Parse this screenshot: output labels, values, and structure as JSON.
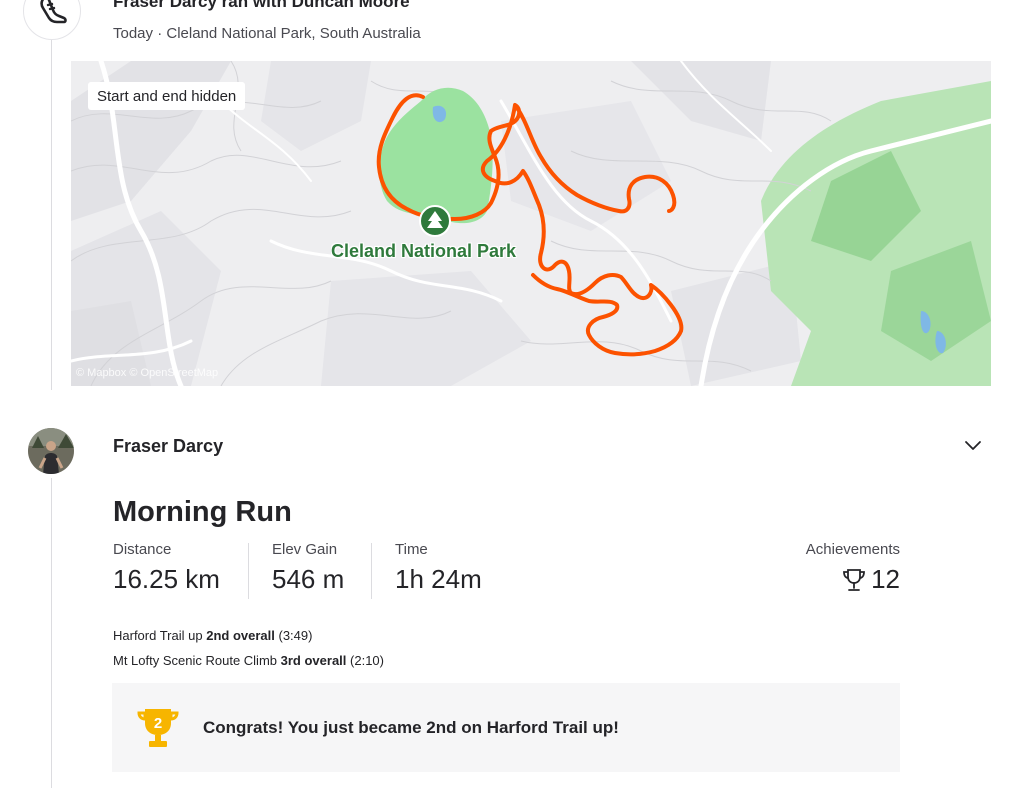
{
  "group": {
    "title": "Fraser Darcy ran with Duncan Moore",
    "subtitle": "Today · Cleland National Park, South Australia",
    "icon": "running-shoe-icon"
  },
  "map": {
    "badge": "Start and end hidden",
    "park_label": "Cleland National Park",
    "attribution": "© Mapbox © OpenStreetMap",
    "route_color": "#fc5200",
    "park_color": "#9be2a0"
  },
  "athlete": {
    "name": "Fraser Darcy",
    "avatar": "avatar-photo"
  },
  "activity": {
    "title": "Morning Run",
    "stats": [
      {
        "label": "Distance",
        "value": "16.25 km"
      },
      {
        "label": "Elev Gain",
        "value": "546 m"
      },
      {
        "label": "Time",
        "value": "1h 24m"
      }
    ],
    "achievements": {
      "label": "Achievements",
      "value": "12",
      "icon": "trophy-icon"
    }
  },
  "segments": [
    {
      "name": "Harford Trail up",
      "rank": "2nd overall",
      "time": "(3:49)"
    },
    {
      "name": "Mt Lofty Scenic Route Climb",
      "rank": "3rd overall",
      "time": "(2:10)"
    }
  ],
  "congrats": {
    "text": "Congrats! You just became 2nd on Harford Trail up!",
    "trophy_number": "2",
    "trophy_color": "#f7b500"
  }
}
